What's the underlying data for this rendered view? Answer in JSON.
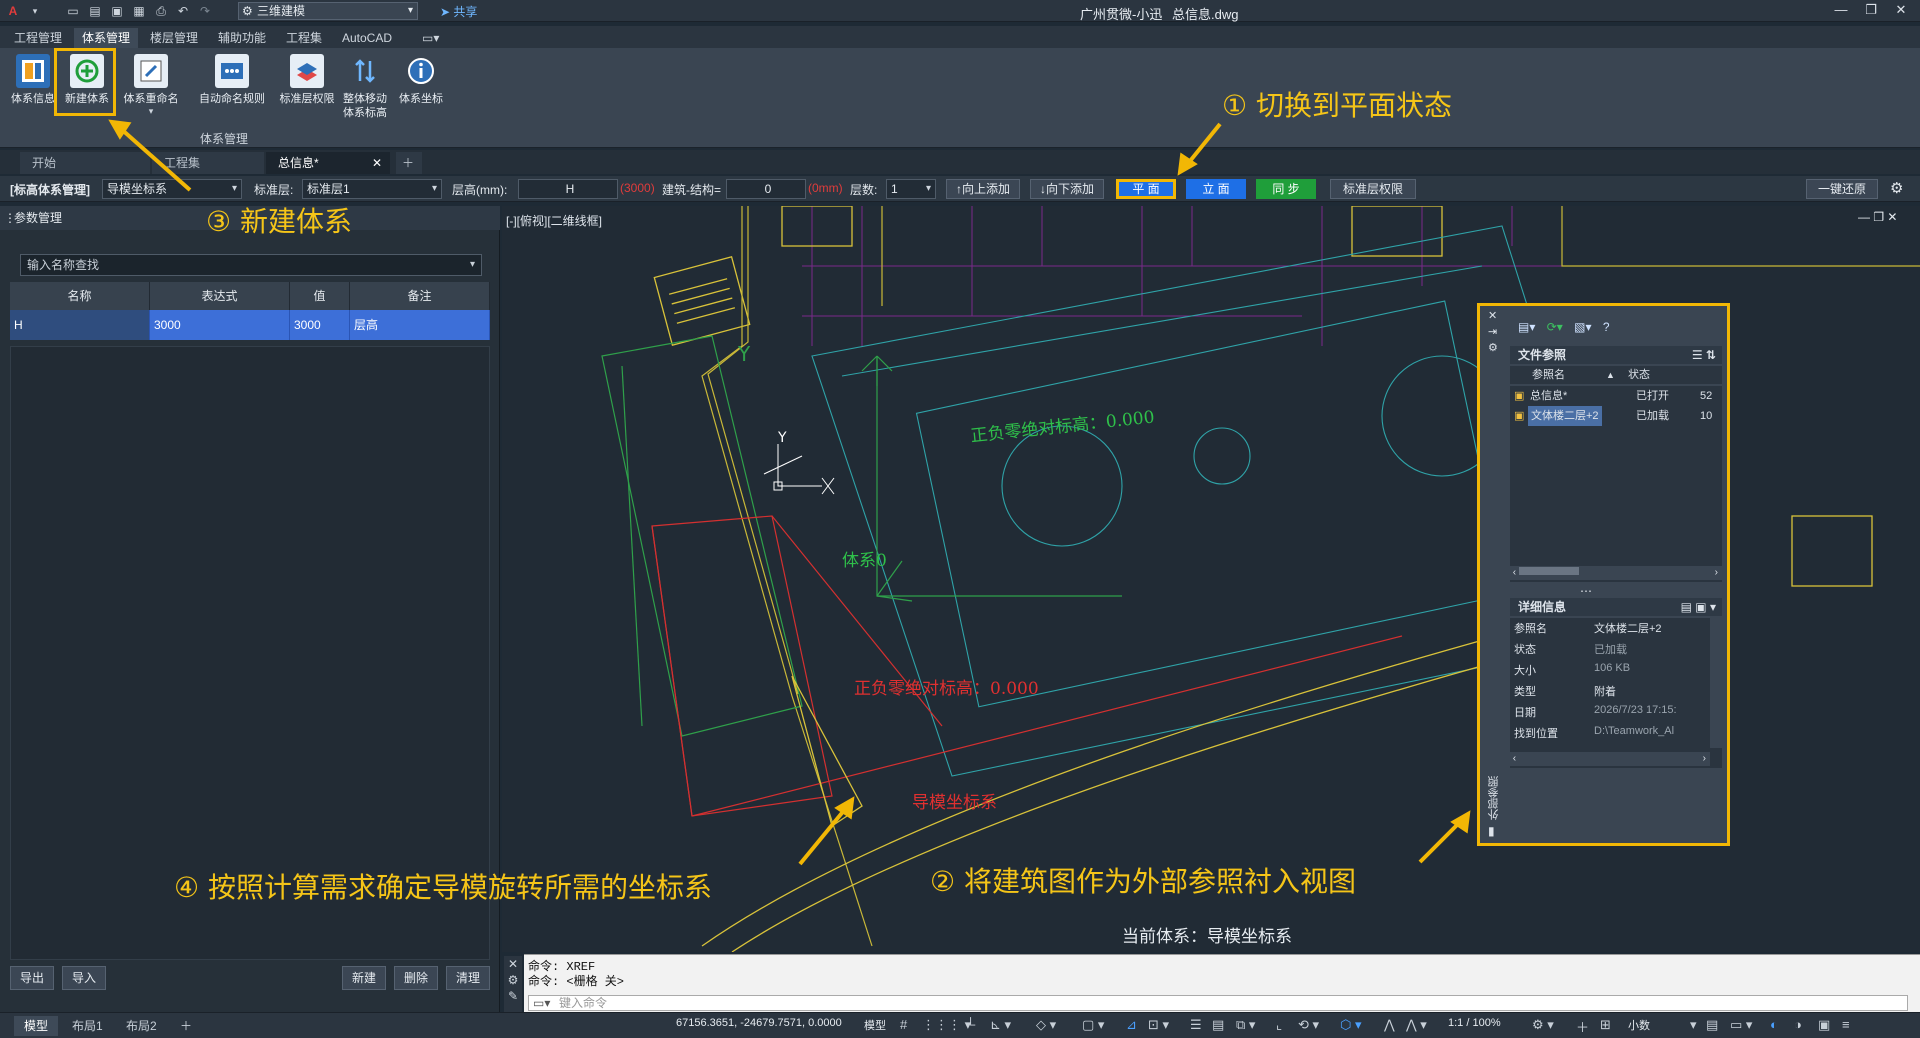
{
  "titlebar": {
    "workspace": "三维建模",
    "share": "共享",
    "app_user": "广州贯微-小迅",
    "filename": "总信息.dwg"
  },
  "ribbon_tabs": [
    "工程管理",
    "体系管理",
    "楼层管理",
    "辅助功能",
    "工程集",
    "AutoCAD"
  ],
  "ribbon": {
    "buttons": [
      {
        "label": "体系信息",
        "icon": "system-info-icon"
      },
      {
        "label": "新建体系",
        "icon": "new-system-icon"
      },
      {
        "label": "体系重命名",
        "icon": "rename-system-icon"
      },
      {
        "label": "自动命名规则",
        "icon": "auto-naming-icon"
      },
      {
        "label": "标准层权限",
        "icon": "standard-floor-permission-icon"
      },
      {
        "label": "整体移动\n体系标高",
        "icon": "move-elevation-icon"
      },
      {
        "label": "体系坐标",
        "icon": "system-coordinate-icon"
      }
    ],
    "group_label": "体系管理"
  },
  "doc_tabs": [
    "开始",
    "工程集",
    "总信息*"
  ],
  "toolbar": {
    "elev_system_label": "[标高体系管理]",
    "elev_system_value": "导模坐标系",
    "std_floor_label": "标准层:",
    "std_floor_value": "标准层1",
    "floor_height_label": "层高(mm):",
    "floor_height_value": "H",
    "floor_height_note": "(3000)",
    "struct_label": "建筑-结构=",
    "struct_value": "0",
    "struct_note": "(0mm)",
    "layers_label": "层数:",
    "layers_value": "1",
    "add_up": "↑向上添加",
    "add_down": "↓向下添加",
    "plan_btn": "平 面",
    "elev_btn": "立 面",
    "sync_btn": "同 步",
    "std_perm_btn": "标准层权限",
    "restore_btn": "一键还原"
  },
  "left_panel": {
    "title": "参数管理",
    "search_placeholder": "输入名称查找",
    "columns": [
      "名称",
      "表达式",
      "值",
      "备注"
    ],
    "rows": [
      {
        "name": "H",
        "expr": "3000",
        "value": "3000",
        "note": "层高"
      }
    ],
    "buttons": {
      "export": "导出",
      "import": "导入",
      "new": "新建",
      "delete": "删除",
      "clear": "清理"
    }
  },
  "canvas": {
    "viewport_label": "[-][俯视][二维线框]",
    "current_system": "当前体系：导模坐标系",
    "green_label": "正负零绝对标高：0.000",
    "red_label": "正负零绝对标高：0.000",
    "green_system": "体系0",
    "red_system": "导模坐标系",
    "y_axis": "Y"
  },
  "xref_panel": {
    "section_files": "文件参照",
    "col_name": "参照名",
    "col_status": "状态",
    "files": [
      {
        "name": "总信息*",
        "status": "已打开",
        "extra": "52"
      },
      {
        "name": "文体楼二层+2",
        "status": "已加载",
        "extra": "10"
      }
    ],
    "section_details": "详细信息",
    "details": [
      {
        "k": "参照名",
        "v": "文体楼二层+2"
      },
      {
        "k": "状态",
        "v": "已加载"
      },
      {
        "k": "大小",
        "v": "106 KB"
      },
      {
        "k": "类型",
        "v": "附着"
      },
      {
        "k": "日期",
        "v": "2026/7/23 17:15:"
      },
      {
        "k": "找到位置",
        "v": "D:\\Teamwork_Al"
      }
    ],
    "side_label": "外部参照"
  },
  "annotations": {
    "a1": "① 切换到平面状态",
    "a2": "② 将建筑图作为外部参照衬入视图",
    "a3": "③ 新建体系",
    "a4": "④ 按照计算需求确定导模旋转所需的坐标系"
  },
  "command": {
    "line1": "命令:  XREF",
    "line2": "命令:  <栅格 关>",
    "placeholder": "键入命令"
  },
  "status": {
    "tabs": [
      "模型",
      "布局1",
      "布局2"
    ],
    "coords": "67156.3651, -24679.7571, 0.0000",
    "mode": "模型",
    "scale": "1:1 / 100%",
    "units": "小数"
  },
  "colors": {
    "accent_yellow": "#f2b705",
    "plan_blue": "#1e6fe6",
    "sync_green": "#1f9e3a",
    "selected_row": "#3d6fd8"
  }
}
